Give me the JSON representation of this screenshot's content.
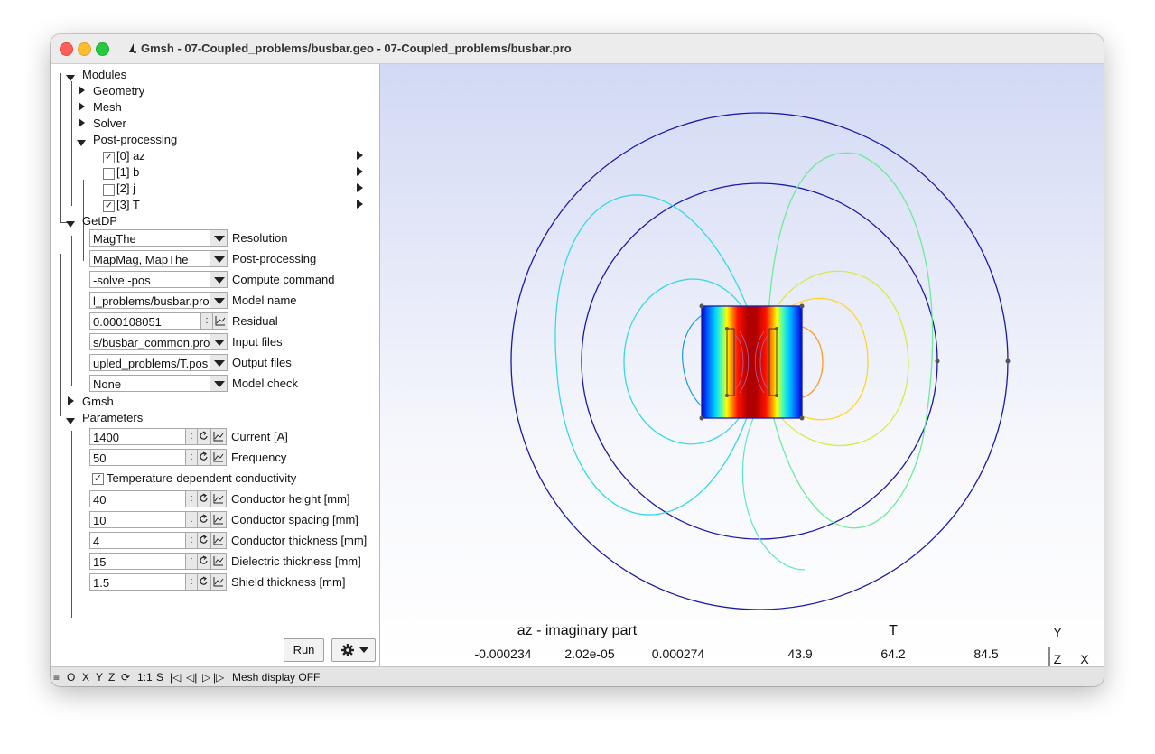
{
  "window": {
    "title": "Gmsh - 07-Coupled_problems/busbar.geo - 07-Coupled_problems/busbar.pro"
  },
  "tree": {
    "modules": "Modules",
    "geometry": "Geometry",
    "mesh": "Mesh",
    "solver": "Solver",
    "postprocessing": "Post-processing",
    "views": [
      {
        "label": "[0] az",
        "checked": true
      },
      {
        "label": "[1] b",
        "checked": false
      },
      {
        "label": "[2] j",
        "checked": false
      },
      {
        "label": "[3] T",
        "checked": true
      }
    ],
    "getdp": "GetDP",
    "gmsh": "Gmsh",
    "parameters": "Parameters"
  },
  "getdp": {
    "resolution": {
      "value": "MagThe",
      "label": "Resolution"
    },
    "postprocessing": {
      "value": "MapMag, MapThe",
      "label": "Post-processing"
    },
    "compute": {
      "value": "-solve -pos",
      "label": "Compute command"
    },
    "model": {
      "value": "l_problems/busbar.pro",
      "label": "Model name"
    },
    "residual": {
      "value": "0.000108051",
      "label": "Residual"
    },
    "input": {
      "value": "s/busbar_common.pro",
      "label": "Input files"
    },
    "output": {
      "value": "upled_problems/T.pos",
      "label": "Output files"
    },
    "check": {
      "value": "None",
      "label": "Model check"
    }
  },
  "parameters": {
    "current": {
      "value": "1400",
      "label": "Current [A]"
    },
    "frequency": {
      "value": "50",
      "label": "Frequency"
    },
    "tempdep": {
      "label": "Temperature-dependent conductivity",
      "checked": true
    },
    "height": {
      "value": "40",
      "label": "Conductor height [mm]"
    },
    "spacing": {
      "value": "10",
      "label": "Conductor spacing [mm]"
    },
    "thickness": {
      "value": "4",
      "label": "Conductor thickness [mm]"
    },
    "dielectric": {
      "value": "15",
      "label": "Dielectric thickness [mm]"
    },
    "shield": {
      "value": "1.5",
      "label": "Shield thickness [mm]"
    }
  },
  "buttons": {
    "run": "Run",
    "spinner_sep": ":"
  },
  "icons": {
    "tree_expanded": "triangle-down-icon",
    "tree_collapsed": "triangle-right-icon",
    "view_options": "triangle-right-icon",
    "dropdown": "chevron-down-icon",
    "loop": "loop-icon",
    "graph": "graph-icon",
    "gear": "gear-icon"
  },
  "statusbar": {
    "menu": "≡",
    "o": "O",
    "x": "X",
    "y": "Y",
    "z": "Z",
    "rotate": "⟳",
    "scale": "1:1",
    "s": "S",
    "first": "|◁",
    "prev": "◁|",
    "play": "▷",
    "next": "|▷",
    "message": "Mesh display OFF"
  },
  "viewport": {
    "az_scale": {
      "title": "az - imaginary part",
      "min": "-0.000234",
      "mid": "2.02e-05",
      "max": "0.000274"
    },
    "t_scale": {
      "title": "T",
      "min": "43.9",
      "mid": "64.2",
      "max": "84.5"
    },
    "axes": {
      "y": "Y",
      "z": "Z",
      "x": "X"
    },
    "colors": {
      "circle": "#1a1aa8",
      "ramp": [
        "#00008f",
        "#0000ff",
        "#00b4ff",
        "#00ffff",
        "#7fff7f",
        "#ffff00",
        "#ff7f00",
        "#ff0000",
        "#7f0000"
      ]
    }
  }
}
